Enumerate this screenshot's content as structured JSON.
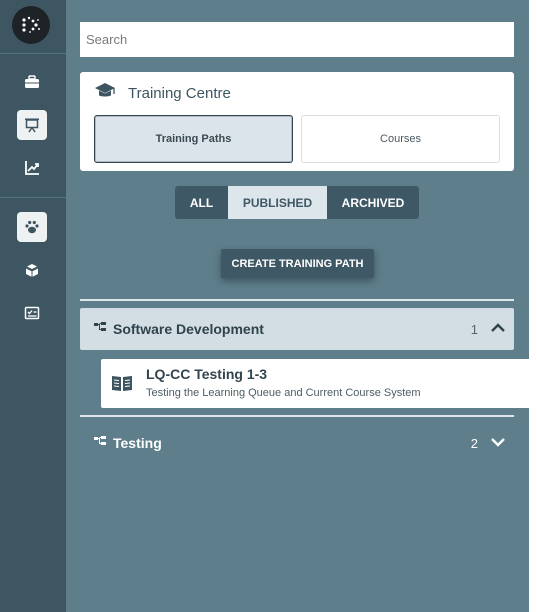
{
  "sidebar": {
    "icons": [
      "logo-icon",
      "briefcase-icon",
      "presentation-icon",
      "chart-icon",
      "paw-icon",
      "book-stack-icon",
      "checklist-icon"
    ]
  },
  "search": {
    "placeholder": "Search",
    "value": ""
  },
  "training_centre": {
    "title": "Training Centre",
    "tabs": [
      {
        "label": "Training Paths",
        "selected": true
      },
      {
        "label": "Courses",
        "selected": false
      }
    ]
  },
  "filter": {
    "options": [
      "ALL",
      "PUBLISHED",
      "ARCHIVED"
    ],
    "selected": "PUBLISHED"
  },
  "create_button": {
    "label": "CREATE TRAINING PATH"
  },
  "groups": [
    {
      "title": "Software Development",
      "count": "1",
      "expanded": true,
      "items": [
        {
          "title": "LQ-CC Testing 1-3",
          "description": "Testing the Learning Queue and Current Course System"
        }
      ]
    },
    {
      "title": "Testing",
      "count": "2",
      "expanded": false
    }
  ],
  "colors": {
    "rail": "#3e5562",
    "main": "#5e7e8c",
    "accent_dark": "#3f5866",
    "accent_light": "#dde6ea"
  }
}
